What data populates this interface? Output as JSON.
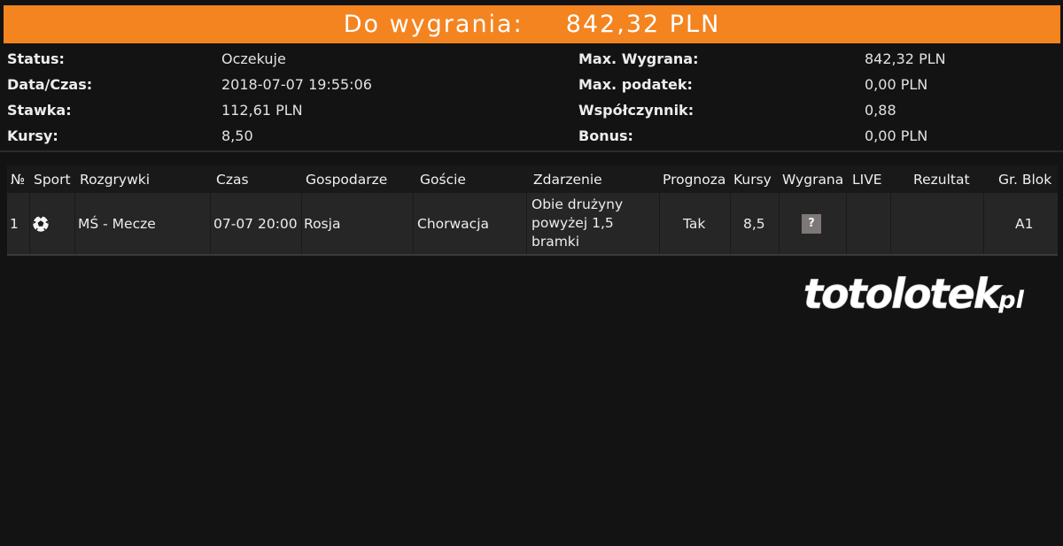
{
  "banner": {
    "label": "Do wygrania:",
    "amount": "842,32 PLN"
  },
  "summary": {
    "status_label": "Status:",
    "status_value": "Oczekuje",
    "datetime_label": "Data/Czas:",
    "datetime_value": "2018-07-07 19:55:06",
    "stake_label": "Stawka:",
    "stake_value": "112,61 PLN",
    "odds_label": "Kursy:",
    "odds_value": "8,50",
    "max_win_label": "Max. Wygrana:",
    "max_win_value": "842,32 PLN",
    "max_tax_label": "Max. podatek:",
    "max_tax_value": "0,00 PLN",
    "coef_label": "Współczynnik:",
    "coef_value": "0,88",
    "bonus_label": "Bonus:",
    "bonus_value": "0,00 PLN"
  },
  "table": {
    "headers": [
      "№",
      "Sport",
      "Rozgrywki",
      "Czas",
      "Gospodarze",
      "Goście",
      "Zdarzenie",
      "Prognoza",
      "Kursy",
      "Wygrana",
      "LIVE",
      "Rezultat",
      "Gr. Blok"
    ],
    "rows": [
      {
        "no": "1",
        "sport_icon": "soccer-ball-icon",
        "competition": "MŚ - Mecze",
        "time": "07-07 20:00",
        "home": "Rosja",
        "away": "Chorwacja",
        "event": "Obie drużyny powyżej 1,5 bramki",
        "prediction": "Tak",
        "odds": "8,5",
        "win_status": "?",
        "live": "",
        "result": "",
        "group_block": "A1"
      }
    ]
  },
  "logo": {
    "text_main": "totolotek",
    "text_suffix": ".pl"
  },
  "colors": {
    "accent": "#f48420",
    "background": "#131313",
    "row_bg": "#262626"
  }
}
